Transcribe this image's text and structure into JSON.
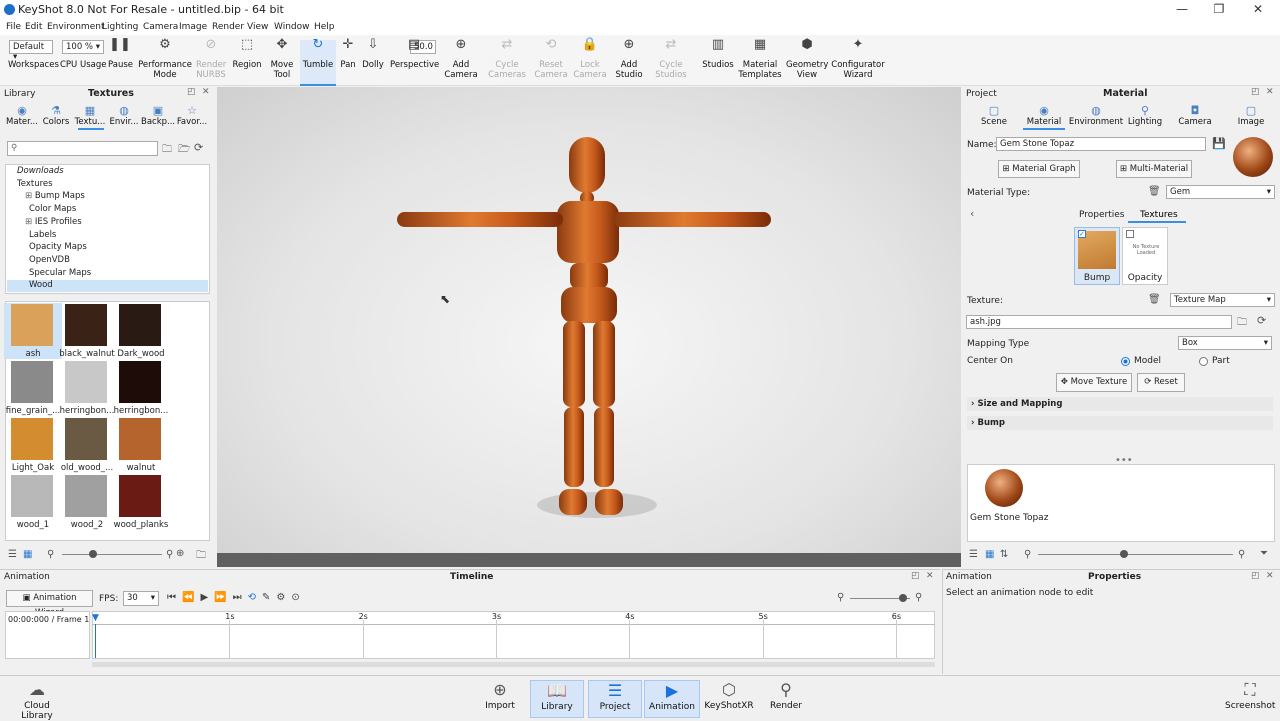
{
  "window": {
    "title": "KeyShot 8.0 Not For Resale - untitled.bip - 64 bit",
    "minimize": "—",
    "maximize": "❐",
    "close": "✕"
  },
  "menu": [
    "File",
    "Edit",
    "Environment",
    "Lighting",
    "Camera",
    "Image",
    "Render",
    "View",
    "Window",
    "Help"
  ],
  "toolbar": {
    "workspace_value": "Default",
    "cpu_value": "100 %",
    "focal_value": "50.0",
    "items": [
      {
        "label": "Workspaces",
        "icon": "workspaces-icon"
      },
      {
        "label": "CPU Usage",
        "icon": "cpu-icon"
      },
      {
        "label": "Pause",
        "icon": "pause-icon"
      },
      {
        "label": "Performance\nMode",
        "icon": "performance-icon"
      },
      {
        "label": "Render\nNURBS",
        "icon": "nurbs-icon",
        "disabled": true
      },
      {
        "label": "Region",
        "icon": "region-icon"
      },
      {
        "label": "Move\nTool",
        "icon": "move-tool-icon"
      },
      {
        "label": "Tumble",
        "icon": "tumble-icon",
        "active": true
      },
      {
        "label": "Pan",
        "icon": "pan-icon"
      },
      {
        "label": "Dolly",
        "icon": "dolly-icon"
      },
      {
        "label": "Perspective",
        "icon": "perspective-icon"
      },
      {
        "label": "Add\nCamera",
        "icon": "add-camera-icon"
      },
      {
        "label": "Cycle\nCameras",
        "icon": "cycle-cameras-icon",
        "disabled": true
      },
      {
        "label": "Reset\nCamera",
        "icon": "reset-camera-icon",
        "disabled": true
      },
      {
        "label": "Lock\nCamera",
        "icon": "lock-camera-icon",
        "disabled": true
      },
      {
        "label": "Add\nStudio",
        "icon": "add-studio-icon"
      },
      {
        "label": "Cycle\nStudios",
        "icon": "cycle-studios-icon",
        "disabled": true
      },
      {
        "label": "Studios",
        "icon": "studios-icon"
      },
      {
        "label": "Material\nTemplates",
        "icon": "material-templates-icon"
      },
      {
        "label": "Geometry\nView",
        "icon": "geometry-view-icon"
      },
      {
        "label": "Configurator\nWizard",
        "icon": "configurator-icon"
      }
    ]
  },
  "library": {
    "header": "Library",
    "title": "Textures",
    "tabs": [
      "Mater...",
      "Colors",
      "Textu...",
      "Envir...",
      "Backp...",
      "Favor..."
    ],
    "search_placeholder": "",
    "tree": [
      "Downloads",
      "Textures",
      "Bump Maps",
      "Color Maps",
      "IES Profiles",
      "Labels",
      "Opacity Maps",
      "OpenVDB",
      "Specular Maps",
      "Wood"
    ],
    "thumbs": [
      {
        "label": "ash",
        "color": "#d9a15a"
      },
      {
        "label": "black_walnut",
        "color": "#3a2216"
      },
      {
        "label": "Dark_wood",
        "color": "#2a1a14"
      },
      {
        "label": "fine_grain_...",
        "color": "#8a8a8a"
      },
      {
        "label": "herringbon...",
        "color": "#c8c8c8"
      },
      {
        "label": "herringbon...",
        "color": "#1e0c08"
      },
      {
        "label": "Light_Oak",
        "color": "#d48c30"
      },
      {
        "label": "old_wood_...",
        "color": "#6a5a44"
      },
      {
        "label": "walnut",
        "color": "#b4642c"
      },
      {
        "label": "wood_1",
        "color": "#b8b8b8"
      },
      {
        "label": "wood_2",
        "color": "#a0a0a0"
      },
      {
        "label": "wood_planks",
        "color": "#6a1c14"
      }
    ]
  },
  "project": {
    "header": "Project",
    "title": "Material",
    "tabs": [
      "Scene",
      "Material",
      "Environment",
      "Lighting",
      "Camera",
      "Image"
    ],
    "name_label": "Name:",
    "name_value": "Gem Stone Topaz",
    "material_graph": "Material Graph",
    "multi_material": "Multi-Material",
    "material_type_label": "Material Type:",
    "material_type_value": "Gem",
    "subtabs": [
      "Properties",
      "Textures"
    ],
    "slots": [
      {
        "label": "Bump",
        "checked": true
      },
      {
        "label": "Opacity",
        "checked": false,
        "note": "No Texture Loaded"
      }
    ],
    "texture_label": "Texture:",
    "texture_type": "Texture Map",
    "texture_file": "ash.jpg",
    "mapping_label": "Mapping Type",
    "mapping_value": "Box",
    "center_label": "Center On",
    "center_opts": [
      "Model",
      "Part"
    ],
    "move_texture": "Move Texture",
    "reset": "Reset",
    "sections": [
      "Size and Mapping",
      "Bump"
    ],
    "preview_name": "Gem Stone Topaz"
  },
  "timeline": {
    "header": "Animation",
    "title": "Timeline",
    "wizard": "Animation Wizard",
    "fps_label": "FPS:",
    "fps_value": "30",
    "frame": "00:00:000 / Frame 1",
    "ticks": [
      "1s",
      "2s",
      "3s",
      "4s",
      "5s",
      "6s"
    ]
  },
  "props": {
    "header": "Animation",
    "title": "Properties",
    "hint": "Select an animation node to edit"
  },
  "bottom": {
    "cloud": "Cloud Library",
    "items": [
      "Import",
      "Library",
      "Project",
      "Animation",
      "KeyShotXR",
      "Render"
    ],
    "screenshot": "Screenshot"
  }
}
